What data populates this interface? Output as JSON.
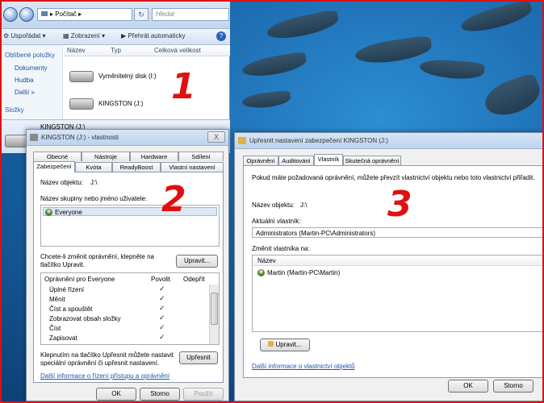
{
  "explorer": {
    "address": "Počítač",
    "search_placeholder": "Hledat",
    "toolbar": {
      "organize": "Uspořádat",
      "views": "Zobrazení",
      "autoplay": "Přehrát automaticky"
    },
    "sidebar": {
      "favorites_header": "Oblíbené položky",
      "items": [
        "Dokumenty",
        "Hudba"
      ],
      "more": "Další",
      "folders": "Složky"
    },
    "columns": [
      "Název",
      "Typ",
      "Celková velikost"
    ],
    "drives": [
      "Vyměnitelný disk (I:)",
      "KINGSTON (J:)"
    ],
    "details_title": "KINGSTON (J:)"
  },
  "annotations": {
    "n1": "1",
    "n2": "2",
    "n3": "3"
  },
  "props_dialog": {
    "title": "KINGSTON (J:) - vlastnosti",
    "close": "X",
    "tabs_row1": [
      "Obecné",
      "Nástroje",
      "Hardware",
      "Sdílení"
    ],
    "tabs_row2": [
      "Zabezpečení",
      "Kvóta",
      "ReadyBoost",
      "Vlastní nastavení"
    ],
    "object_label": "Název objektu:",
    "object_value": "J:\\",
    "groups_label": "Název skupiny nebo jméno uživatele:",
    "groups": [
      "Everyone"
    ],
    "change_text_1": "Chcete-li změnit oprávnění, klepněte na",
    "change_text_2": "tlačítko Upravit.",
    "edit_button": "Upravit...",
    "perm_header": "Oprávnění pro Everyone",
    "allow": "Povolit",
    "deny": "Odepřít",
    "permissions": [
      "Úplné řízení",
      "Měnit",
      "Číst a spouštět",
      "Zobrazovat obsah složky",
      "Číst",
      "Zapisovat"
    ],
    "check_mark": "✓",
    "advanced_text_1": "Klepnutím na tlačítko Upřesnit můžete nastavit",
    "advanced_text_2": "speciální oprávnění či upřesnit nastavení.",
    "advanced_button": "Upřesnit",
    "link": "Další informace o řízení přístupu a oprávnění",
    "ok": "OK",
    "cancel": "Storno",
    "apply": "Použít"
  },
  "advanced_dialog": {
    "title": "Upřesnit nastavení zabezpečení KINGSTON (J:)",
    "tabs": [
      "Oprávnění",
      "Auditování",
      "Vlastník",
      "Skutečná oprávnění"
    ],
    "info": "Pokud máte požadovaná oprávnění, můžete převzít vlastnictví objektu nebo toto vlastnictví přiřadit.",
    "object_label": "Název objektu:",
    "object_value": "J:\\",
    "owner_label": "Aktuální vlastník:",
    "owner_value": "Administrators (Martin-PC\\Administrators)",
    "change_label": "Změnit vlastníka na:",
    "list_header": "Název",
    "list_items": [
      "Martin (Martin-PC\\Martin)"
    ],
    "edit_button": "Upravit...",
    "link": "Další informace o vlastnictví objektů",
    "ok": "OK",
    "cancel": "Storno"
  }
}
